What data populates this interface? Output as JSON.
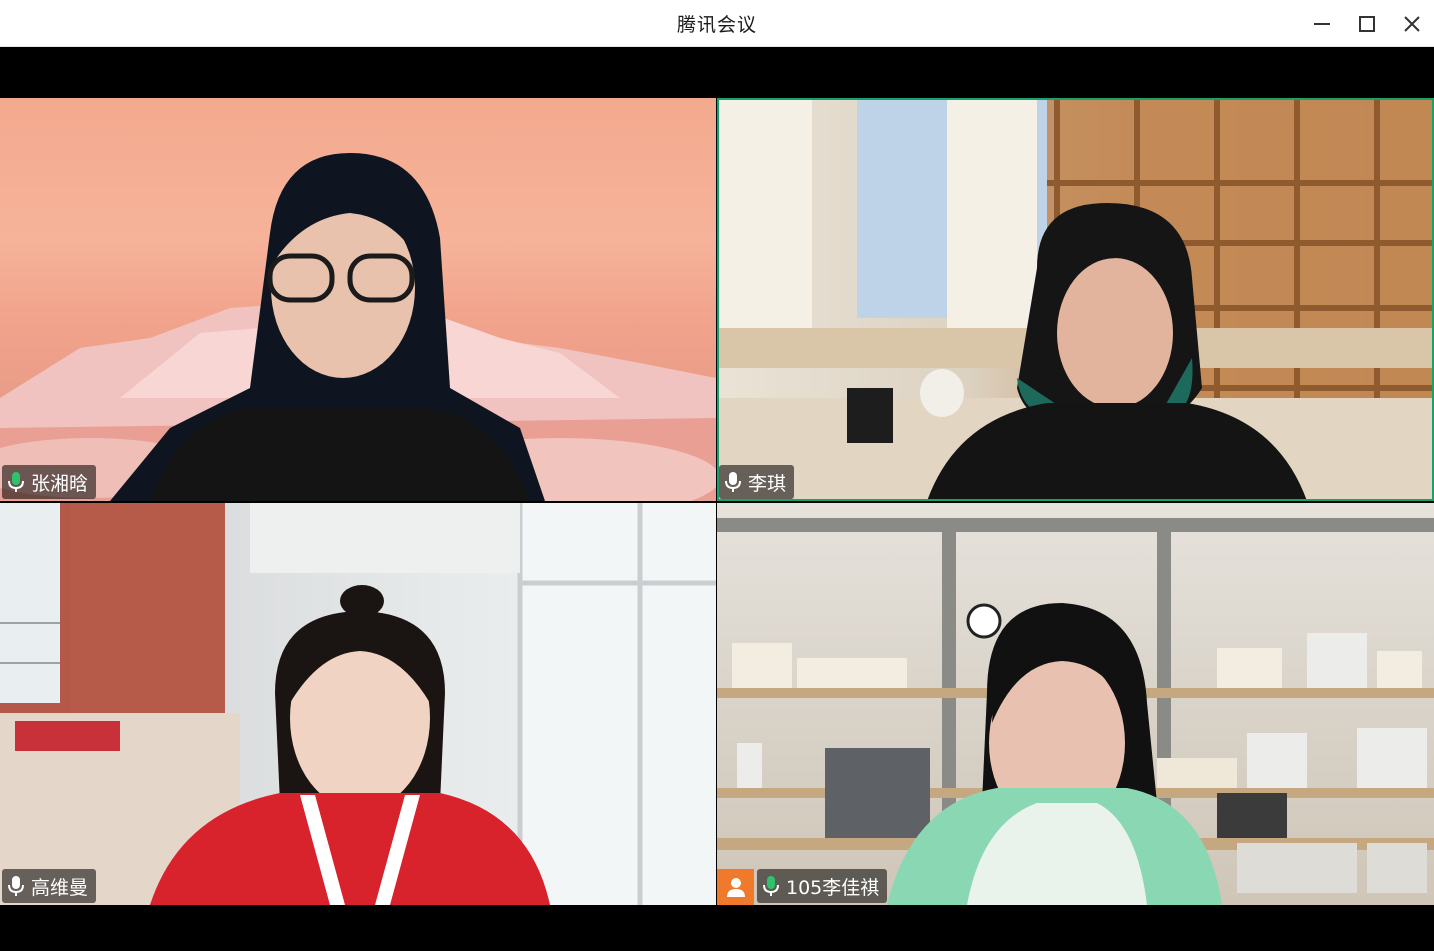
{
  "window": {
    "title": "腾讯会议",
    "controls": {
      "minimize": "minimize-icon",
      "maximize": "maximize-icon",
      "close": "close-icon"
    }
  },
  "participants": [
    {
      "name": "张湘晗",
      "mic": "on",
      "active_speaker": false
    },
    {
      "name": "李琪",
      "mic": "on",
      "active_speaker": true
    },
    {
      "name": "高维曼",
      "mic": "on",
      "active_speaker": false
    },
    {
      "name": "105李佳祺",
      "mic": "on",
      "active_speaker": false,
      "avatar_icon": "person-icon"
    }
  ],
  "colors": {
    "titlebar_bg": "#ffffff",
    "stage_bg": "#000000",
    "mic_green": "#2fc26a",
    "active_border": "#16a36b",
    "avatar_orange": "#f07a2c"
  }
}
